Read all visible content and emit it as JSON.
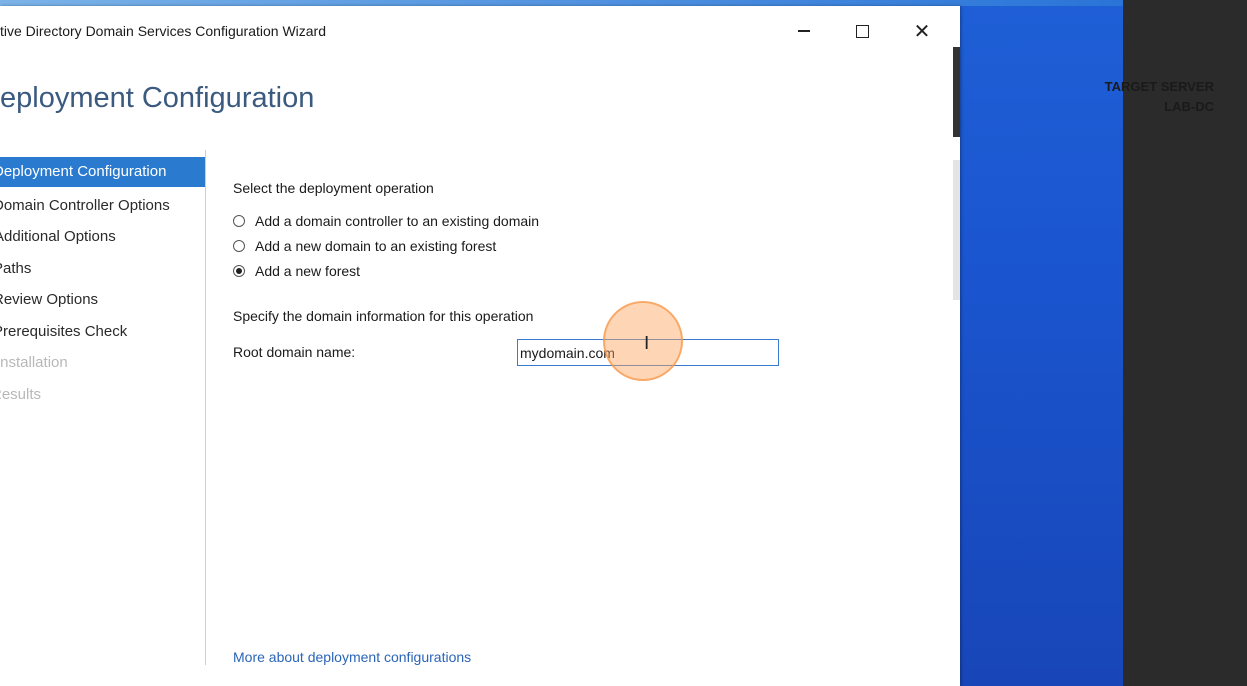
{
  "window": {
    "title": "tive Directory Domain Services Configuration Wizard",
    "controls": {
      "minimize": "–",
      "maximize": "□",
      "close": "✕"
    }
  },
  "header": {
    "page_title": "eployment Configuration",
    "target_server_label": "TARGET SERVER",
    "target_server_name": "LAB-DC"
  },
  "nav": {
    "items": [
      {
        "label": "Deployment Configuration",
        "state": "active"
      },
      {
        "label": "Domain Controller Options",
        "state": "normal"
      },
      {
        "label": "Additional Options",
        "state": "normal"
      },
      {
        "label": "Paths",
        "state": "normal"
      },
      {
        "label": "Review Options",
        "state": "normal"
      },
      {
        "label": "Prerequisites Check",
        "state": "normal"
      },
      {
        "label": "Installation",
        "state": "disabled"
      },
      {
        "label": "Results",
        "state": "disabled"
      }
    ]
  },
  "main": {
    "operation_heading": "Select the deployment operation",
    "options": [
      {
        "label": "Add a domain controller to an existing domain",
        "checked": false
      },
      {
        "label": "Add a new domain to an existing forest",
        "checked": false
      },
      {
        "label": "Add a new forest",
        "checked": true
      }
    ],
    "domain_info_heading": "Specify the domain information for this operation",
    "root_domain_label": "Root domain name:",
    "root_domain_value": "mydomain.com",
    "more_link": "More about deployment configurations"
  },
  "colors": {
    "accent": "#2a7bcf",
    "title": "#3a5a80",
    "link": "#2a65b8",
    "desktop": "#1a55cf"
  }
}
